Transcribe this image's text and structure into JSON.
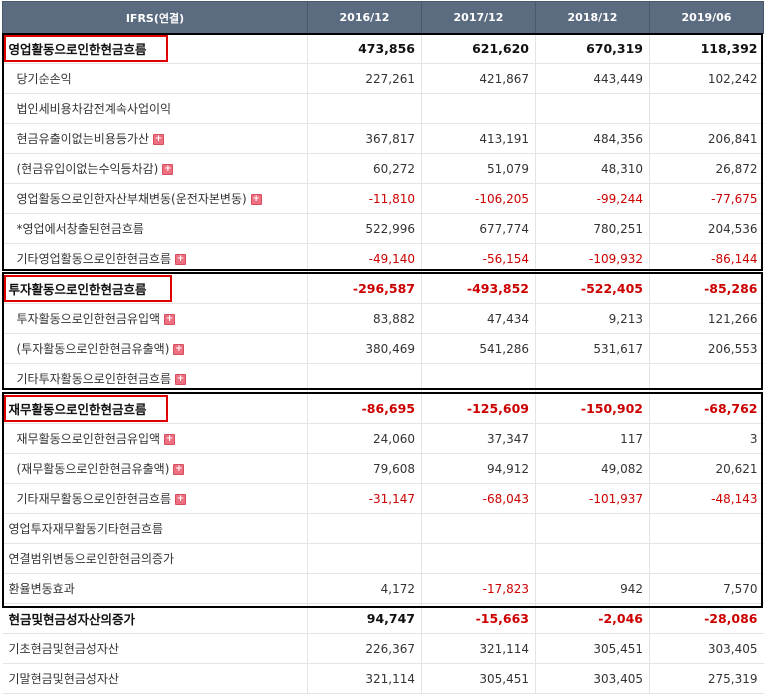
{
  "header": {
    "label": "IFRS(연결)",
    "periods": [
      "2016/12",
      "2017/12",
      "2018/12",
      "2019/06"
    ]
  },
  "rows": [
    {
      "label": "영업활동으로인한현금흐름",
      "values": [
        "473,856",
        "621,620",
        "670,319",
        "118,392"
      ],
      "type": "section",
      "expand": false
    },
    {
      "label": "당기순손익",
      "values": [
        "227,261",
        "421,867",
        "443,449",
        "102,242"
      ],
      "type": "sub",
      "expand": false
    },
    {
      "label": "법인세비용차감전계속사업이익",
      "values": [
        "",
        "",
        "",
        ""
      ],
      "type": "sub",
      "expand": false
    },
    {
      "label": "현금유출이없는비용등가산",
      "values": [
        "367,817",
        "413,191",
        "484,356",
        "206,841"
      ],
      "type": "sub",
      "expand": true
    },
    {
      "label": "(현금유입이없는수익등차감)",
      "values": [
        "60,272",
        "51,079",
        "48,310",
        "26,872"
      ],
      "type": "sub",
      "expand": true
    },
    {
      "label": "영업활동으로인한자산부채변동(운전자본변동)",
      "values": [
        "-11,810",
        "-106,205",
        "-99,244",
        "-77,675"
      ],
      "type": "sub",
      "expand": true
    },
    {
      "label": "*영업에서창출된현금흐름",
      "values": [
        "522,996",
        "677,774",
        "780,251",
        "204,536"
      ],
      "type": "sub",
      "expand": false
    },
    {
      "label": "기타영업활동으로인한현금흐름",
      "values": [
        "-49,140",
        "-56,154",
        "-109,932",
        "-86,144"
      ],
      "type": "sub",
      "expand": true
    },
    {
      "label": "투자활동으로인한현금흐름",
      "values": [
        "-296,587",
        "-493,852",
        "-522,405",
        "-85,286"
      ],
      "type": "section",
      "expand": false
    },
    {
      "label": "투자활동으로인한현금유입액",
      "values": [
        "83,882",
        "47,434",
        "9,213",
        "121,266"
      ],
      "type": "sub",
      "expand": true
    },
    {
      "label": "(투자활동으로인한현금유출액)",
      "values": [
        "380,469",
        "541,286",
        "531,617",
        "206,553"
      ],
      "type": "sub",
      "expand": true
    },
    {
      "label": "기타투자활동으로인한현금흐름",
      "values": [
        "",
        "",
        "",
        ""
      ],
      "type": "sub",
      "expand": true
    },
    {
      "label": "재무활동으로인한현금흐름",
      "values": [
        "-86,695",
        "-125,609",
        "-150,902",
        "-68,762"
      ],
      "type": "section",
      "expand": false
    },
    {
      "label": "재무활동으로인한현금유입액",
      "values": [
        "24,060",
        "37,347",
        "117",
        "3"
      ],
      "type": "sub",
      "expand": true
    },
    {
      "label": "(재무활동으로인한현금유출액)",
      "values": [
        "79,608",
        "94,912",
        "49,082",
        "20,621"
      ],
      "type": "sub",
      "expand": true
    },
    {
      "label": "기타재무활동으로인한현금흐름",
      "values": [
        "-31,147",
        "-68,043",
        "-101,937",
        "-48,143"
      ],
      "type": "sub",
      "expand": true
    },
    {
      "label": "영업투자재무활동기타현금흐름",
      "values": [
        "",
        "",
        "",
        ""
      ],
      "type": "flat",
      "expand": false
    },
    {
      "label": "연결범위변동으로인한현금의증가",
      "values": [
        "",
        "",
        "",
        ""
      ],
      "type": "flat",
      "expand": false
    },
    {
      "label": "환율변동효과",
      "values": [
        "4,172",
        "-17,823",
        "942",
        "7,570"
      ],
      "type": "flat",
      "expand": false
    },
    {
      "label": "현금및현금성자산의증가",
      "values": [
        "94,747",
        "-15,663",
        "-2,046",
        "-28,086"
      ],
      "type": "section",
      "expand": false
    },
    {
      "label": "기초현금및현금성자산",
      "values": [
        "226,367",
        "321,114",
        "305,451",
        "303,405"
      ],
      "type": "flat",
      "expand": false
    },
    {
      "label": "기말현금및현금성자산",
      "values": [
        "321,114",
        "305,451",
        "303,405",
        "275,319"
      ],
      "type": "flat",
      "expand": false
    }
  ]
}
